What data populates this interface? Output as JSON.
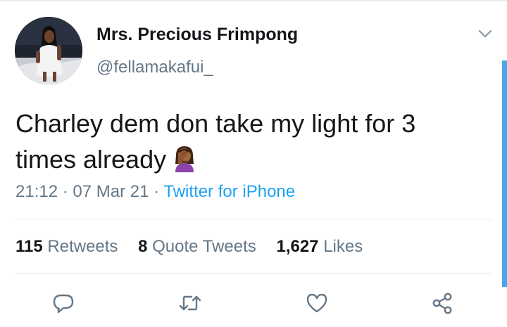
{
  "tweet": {
    "author_name": "Mrs. Precious Frimpong",
    "author_handle": "@fellamakafui_",
    "text": "Charley dem don take my light for 3 times already",
    "emoji": "woman-facepalming-icon",
    "time": "21:12",
    "date": "07 Mar 21",
    "separator": "·",
    "source": "Twitter for iPhone"
  },
  "stats": {
    "retweets_count": "115",
    "retweets_label": "Retweets",
    "quotes_count": "8",
    "quotes_label": "Quote Tweets",
    "likes_count": "1,627",
    "likes_label": "Likes"
  },
  "actions": [
    "reply-icon",
    "retweet-icon",
    "like-icon",
    "share-icon"
  ],
  "colors": {
    "text": "#14171a",
    "secondary": "#657786",
    "link": "#1da1f2",
    "divider": "#e1e8ed",
    "scrollbar": "#4aa6e8"
  }
}
